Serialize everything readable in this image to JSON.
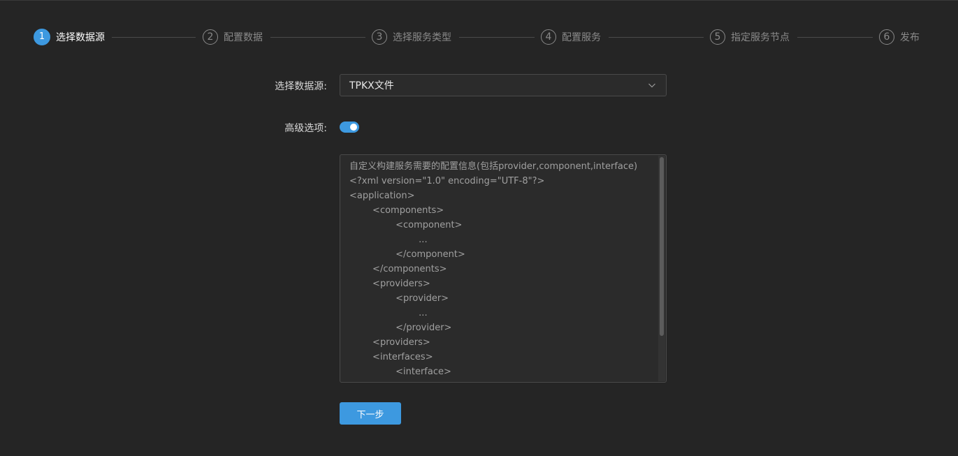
{
  "steps": [
    {
      "num": "1",
      "label": "选择数据源",
      "active": true
    },
    {
      "num": "2",
      "label": "配置数据",
      "active": false
    },
    {
      "num": "3",
      "label": "选择服务类型",
      "active": false
    },
    {
      "num": "4",
      "label": "配置服务",
      "active": false
    },
    {
      "num": "5",
      "label": "指定服务节点",
      "active": false
    },
    {
      "num": "6",
      "label": "发布",
      "active": false
    }
  ],
  "form": {
    "datasource_label": "选择数据源:",
    "datasource_value": "TPKX文件",
    "advanced_label": "高级选项:",
    "advanced_enabled": true,
    "config_text": "自定义构建服务需要的配置信息(包括provider,component,interface)\n<?xml version=\"1.0\" encoding=\"UTF-8\"?>\n<application>\n        <components>\n                <component>\n                        ...\n                </component>\n        </components>\n        <providers>\n                <provider>\n                        ...\n                </provider>\n        <providers>\n        <interfaces>\n                <interface>",
    "next_label": "下一步"
  },
  "colors": {
    "accent": "#3d99e0",
    "background": "#252525"
  }
}
